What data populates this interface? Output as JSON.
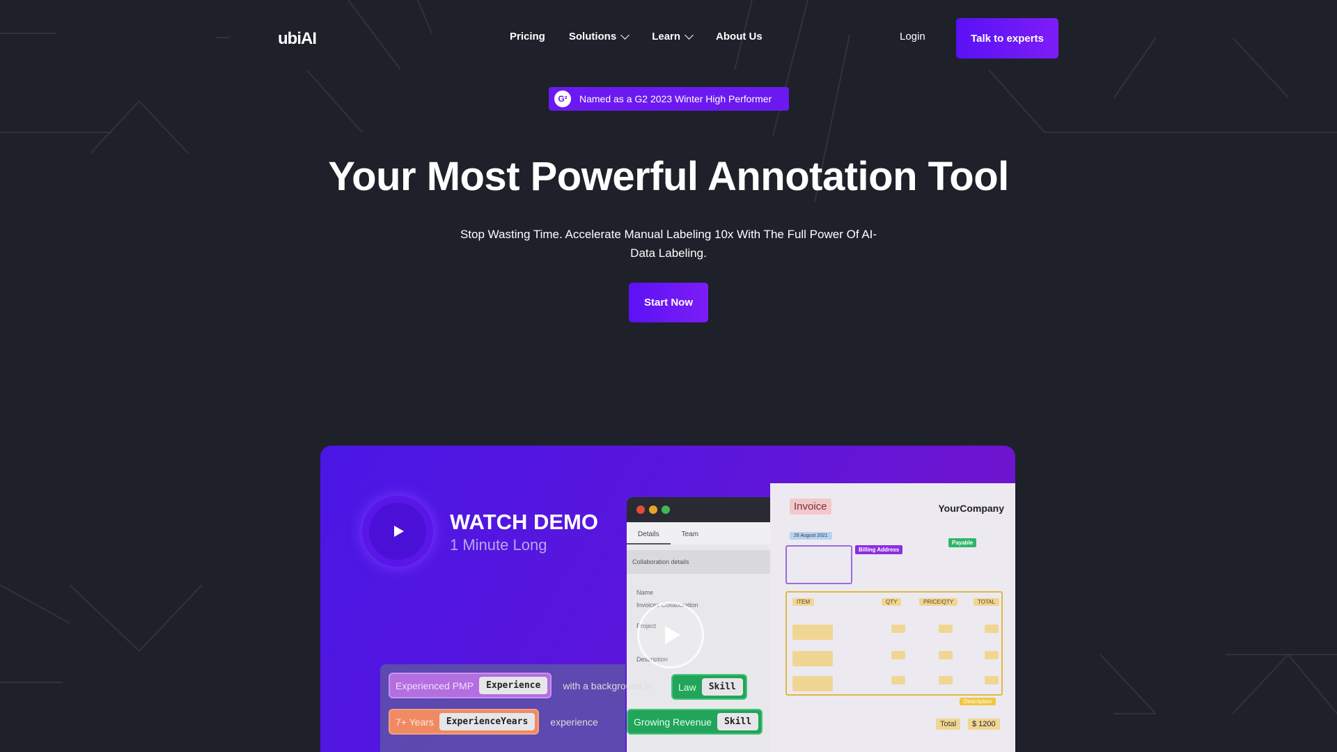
{
  "header": {
    "logo": "ubiAI",
    "nav": [
      {
        "label": "Pricing",
        "has_dropdown": false
      },
      {
        "label": "Solutions",
        "has_dropdown": true
      },
      {
        "label": "Learn",
        "has_dropdown": true
      },
      {
        "label": "About Us",
        "has_dropdown": false
      }
    ],
    "login": "Login",
    "cta": "Talk to experts"
  },
  "badge": {
    "icon": "g2-icon",
    "text": "Named as a G2 2023 Winter High Performer"
  },
  "hero": {
    "title": "Your Most Powerful Annotation Tool",
    "subtitle": "Stop Wasting Time. Accelerate Manual Labeling 10x With The Full Power Of AI-Data Labeling.",
    "button": "Start Now"
  },
  "demo": {
    "title": "WATCH DEMO",
    "subtitle": "1 Minute Long",
    "mock_app": {
      "tabs": [
        "Details",
        "Team"
      ],
      "section": "Collaboration details",
      "fields": [
        "Name",
        "Invoices Collaboration",
        "Project",
        "Description"
      ]
    },
    "invoice": {
      "title": "Invoice",
      "company": "YourCompany",
      "date": "26 August 2021",
      "billing_tag": "Billing Address",
      "payable_tag": "Payable",
      "columns": [
        "ITEM",
        "QTY",
        "PRICE/QTY",
        "TOTAL"
      ],
      "description_tag": "Description",
      "total_label": "Total",
      "total_value": "$ 1200"
    },
    "annotations": [
      {
        "text": "Experienced PMP",
        "label": "Experience",
        "color": "purple"
      },
      {
        "text": "with a background in",
        "plain": true
      },
      {
        "text": "Law",
        "label": "Skill",
        "color": "green"
      },
      {
        "text": "7+ Years",
        "label": "ExperienceYears",
        "color": "orange"
      },
      {
        "text": "experience",
        "plain": true
      },
      {
        "text": "Growing Revenue",
        "label": "Skill",
        "color": "green"
      }
    ]
  },
  "colors": {
    "background": "#1e2129",
    "accent": "#6b19f0",
    "button_gradient_start": "#5a11f5",
    "button_gradient_end": "#7d1df7"
  }
}
